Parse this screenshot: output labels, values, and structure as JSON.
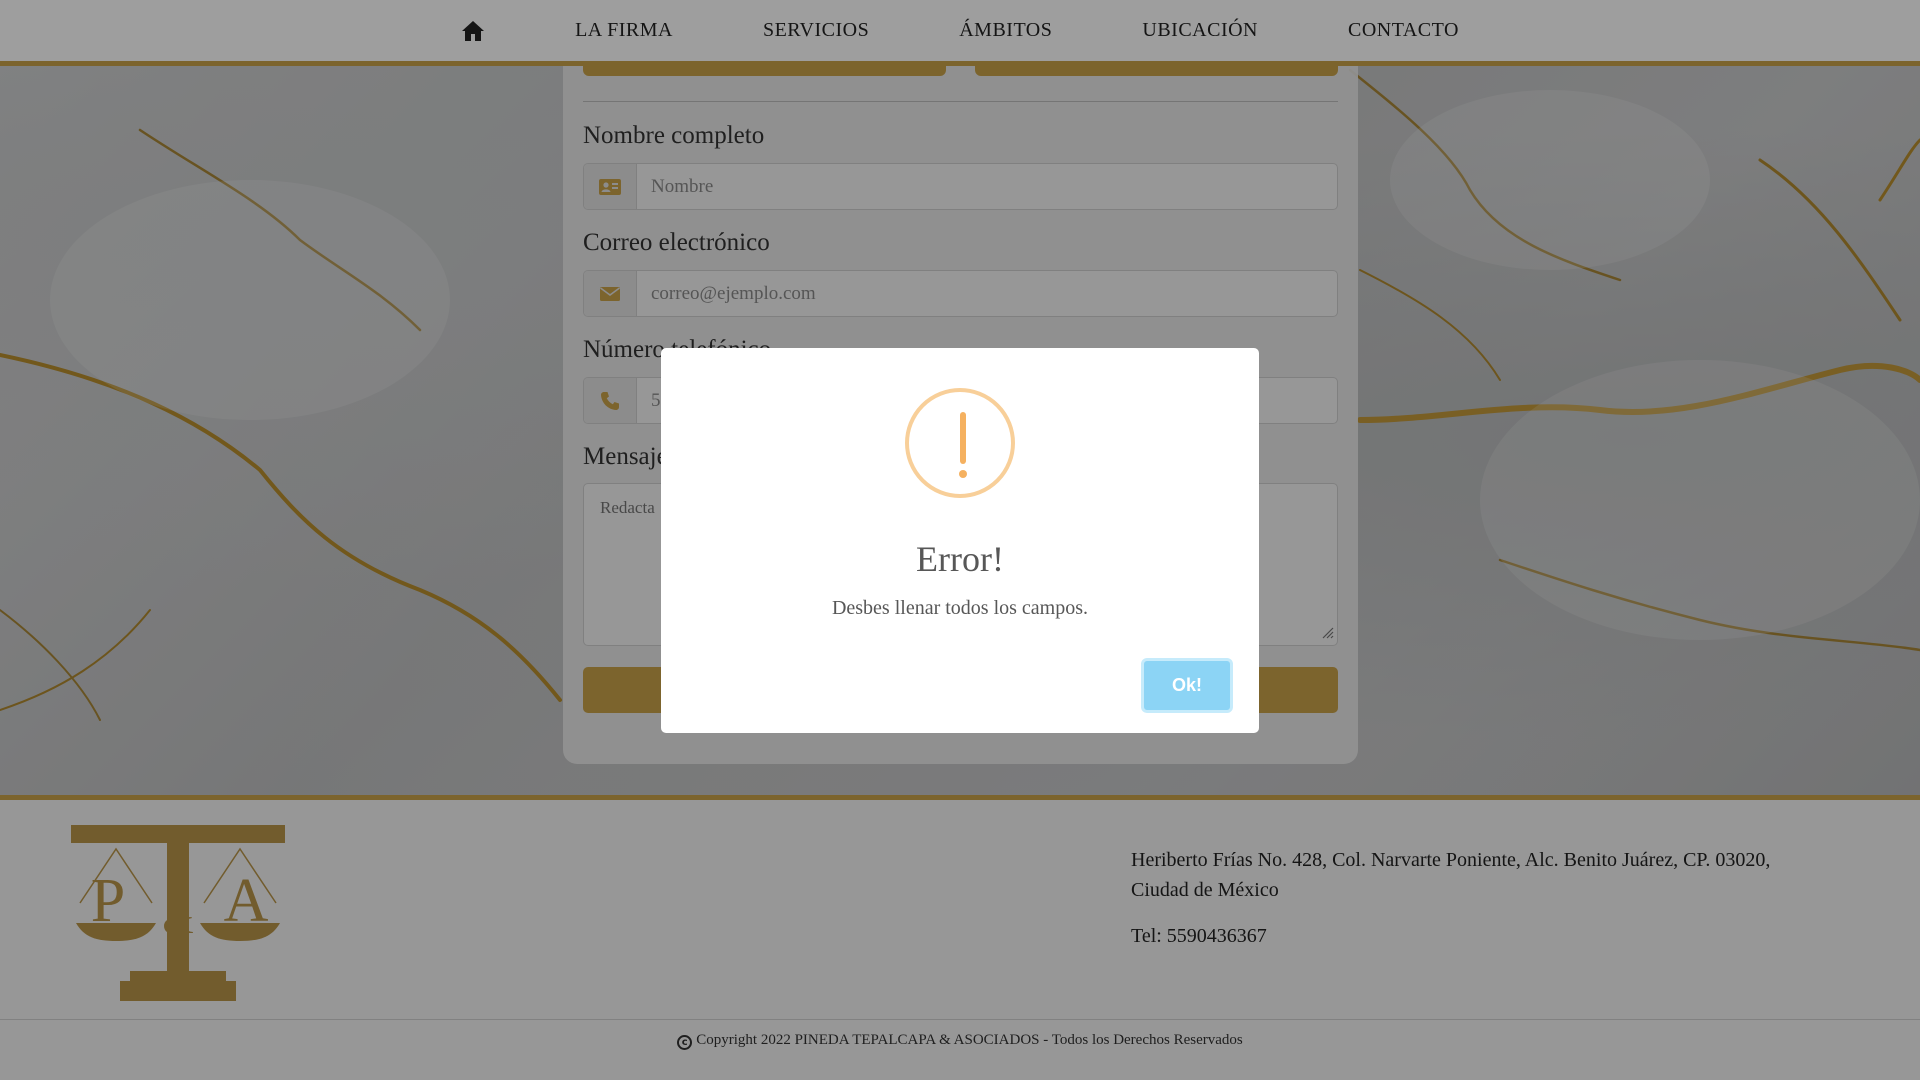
{
  "navbar": {
    "home_icon": "home-icon",
    "items": [
      {
        "label": "LA FIRMA"
      },
      {
        "label": "SERVICIOS"
      },
      {
        "label": "ÁMBITOS"
      },
      {
        "label": "UBICACIÓN"
      },
      {
        "label": "CONTACTO"
      }
    ]
  },
  "form": {
    "name_label": "Nombre completo",
    "name_placeholder": "Nombre",
    "email_label": "Correo electrónico",
    "email_placeholder": "correo@ejemplo.com",
    "phone_label": "Número telefónico",
    "phone_placeholder": "5",
    "message_label": "Mensaje",
    "message_placeholder": "Redacta"
  },
  "modal": {
    "icon": "warning-icon",
    "title": "Error!",
    "text": "Desbes llenar todos los campos.",
    "ok_label": "Ok!"
  },
  "footer": {
    "logo_text": "P&A",
    "address": "Heriberto Frías No. 428, Col. Narvarte Poniente, Alc. Benito Juárez, CP. 03020, Ciudad de México",
    "tel": "Tel: 5590436367",
    "copyright": "Copyright 2022 PINEDA TEPALCAPA & ASOCIADOS - Todos los Derechos Reservados"
  },
  "colors": {
    "gold": "#c9a24a",
    "ok_button": "#8cd4f5",
    "warning": "#f5b160"
  }
}
